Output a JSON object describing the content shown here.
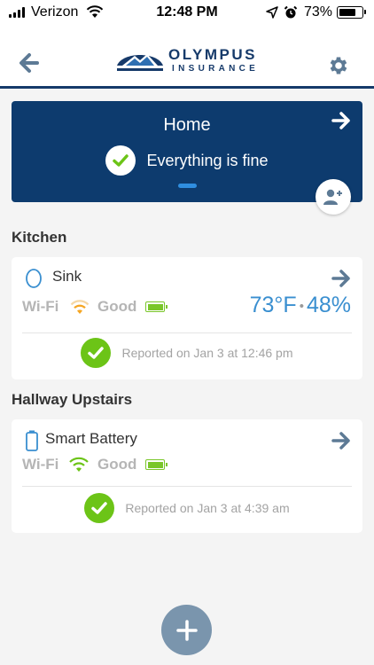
{
  "status_bar": {
    "carrier": "Verizon",
    "time": "12:48 PM",
    "battery_percent": "73%",
    "icons": [
      "signal-bars-icon",
      "wifi-icon",
      "location-arrow-icon",
      "alarm-clock-icon",
      "battery-icon"
    ]
  },
  "header": {
    "logo_name": "OLYMPUS",
    "logo_sub": "INSURANCE",
    "back_icon": "arrow-left-icon",
    "settings_icon": "gear-icon",
    "colors": {
      "brand": "#163a6a"
    }
  },
  "home": {
    "title": "Home",
    "status": "Everything is fine",
    "arrow_icon": "arrow-right-icon",
    "add_user_icon": "add-user-icon",
    "colors": {
      "background": "#0d3b6e",
      "page_indicator": "#2f8ee0"
    }
  },
  "sections": [
    {
      "title": "Kitchen",
      "device": {
        "name": "Sink",
        "icon": "water-sensor-icon",
        "wifi_label": "Wi-Fi",
        "signal_label": "Good",
        "wifi_color": "#f5a623",
        "temperature": "73°F",
        "humidity": "48%",
        "report": "Reported on Jan 3 at 12:46 pm"
      }
    },
    {
      "title": "Hallway Upstairs",
      "device": {
        "name": "Smart Battery",
        "icon": "battery-device-icon",
        "wifi_label": "Wi-Fi",
        "signal_label": "Good",
        "wifi_color": "#6cc417",
        "report": "Reported on Jan 3 at 4:39 am"
      }
    }
  ],
  "fab": {
    "icon": "plus-icon",
    "color": "#7a95ad"
  },
  "colors": {
    "ok_green": "#6cc417",
    "reading_blue": "#3a8fd0",
    "arrow": "#5d7a95"
  }
}
